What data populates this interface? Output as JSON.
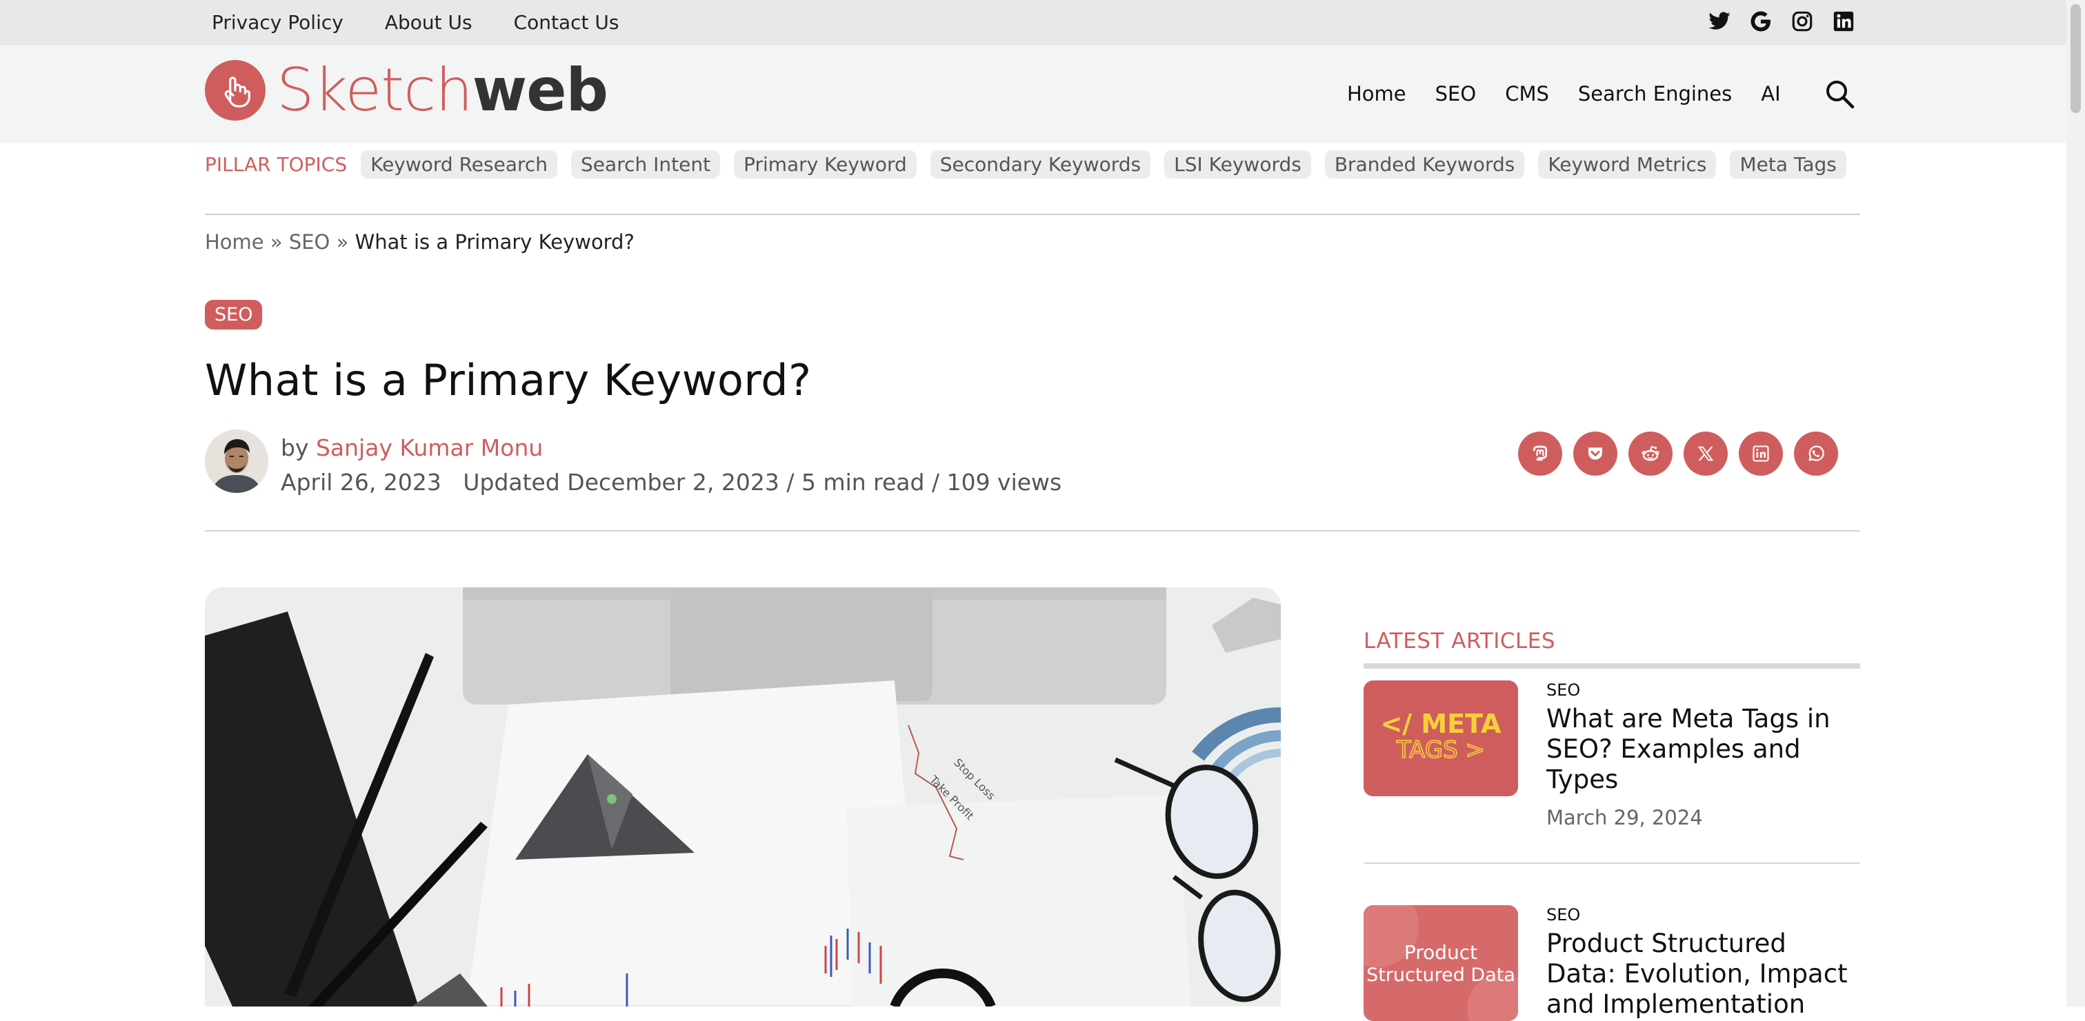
{
  "topbar": {
    "links": [
      "Privacy Policy",
      "About Us",
      "Contact Us"
    ],
    "social_icons": [
      "twitter-icon",
      "google-icon",
      "instagram-icon",
      "linkedin-icon"
    ]
  },
  "header": {
    "logo_part1": "Sketch",
    "logo_part2": "web",
    "nav": [
      "Home",
      "SEO",
      "CMS",
      "Search Engines",
      "AI"
    ]
  },
  "pillar": {
    "label": "PILLAR TOPICS",
    "topics": [
      "Keyword Research",
      "Search Intent",
      "Primary Keyword",
      "Secondary Keywords",
      "LSI Keywords",
      "Branded Keywords",
      "Keyword Metrics",
      "Meta Tags"
    ]
  },
  "breadcrumb": {
    "home": "Home",
    "sep": " » ",
    "section": "SEO",
    "current": "What is a Primary Keyword?"
  },
  "article": {
    "category": "SEO",
    "title": "What is a Primary Keyword?",
    "by": "by ",
    "author": "Sanjay Kumar Monu",
    "meta": "April 26, 2023   Updated December 2, 2023 / 5 min read / 109 views",
    "share_icons": [
      "mastodon-icon",
      "pocket-icon",
      "reddit-icon",
      "x-icon",
      "linkedin-icon",
      "whatsapp-icon"
    ]
  },
  "hero_image": {
    "chart_labels": [
      "Stop Loss",
      "Take Profit"
    ]
  },
  "sidebar": {
    "title": "LATEST ARTICLES",
    "articles": [
      {
        "category": "SEO",
        "title": "What are Meta Tags in SEO? Examples and Types",
        "date": "March 29, 2024",
        "thumb_line1": "</ META",
        "thumb_line2": "TAGS >"
      },
      {
        "category": "SEO",
        "title": "Product Structured Data: Evolution, Impact and Implementation",
        "thumb_line1": "Product",
        "thumb_line2": "Structured Data"
      }
    ]
  },
  "colors": {
    "accent": "#d05d5d"
  }
}
